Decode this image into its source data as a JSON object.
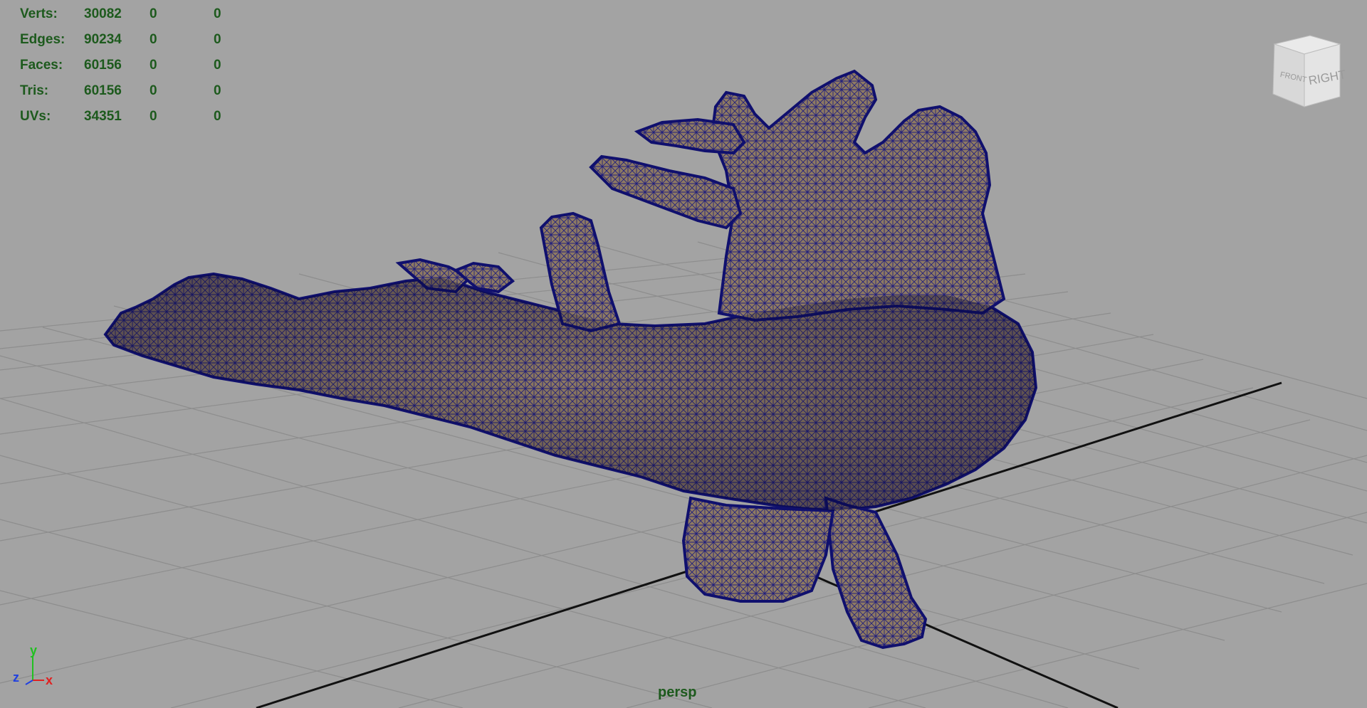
{
  "hud": {
    "rows": [
      {
        "label": "Verts:",
        "count": "30082",
        "selected": "0",
        "component": "0"
      },
      {
        "label": "Edges:",
        "count": "90234",
        "selected": "0",
        "component": "0"
      },
      {
        "label": "Faces:",
        "count": "60156",
        "selected": "0",
        "component": "0"
      },
      {
        "label": "Tris:",
        "count": "60156",
        "selected": "0",
        "component": "0"
      },
      {
        "label": "UVs:",
        "count": "34351",
        "selected": "0",
        "component": "0"
      }
    ]
  },
  "camera": {
    "name": "persp"
  },
  "viewcube": {
    "front_label": "FRONT",
    "right_label": "RIGHT"
  },
  "axis": {
    "y": "y",
    "z": "z",
    "x": "x"
  },
  "colors": {
    "background": "#a3a3a3",
    "grid": "#8c8c8c",
    "grid_axis": "#111111",
    "hud_text": "#1d5a1d",
    "wireframe": "#12127a",
    "surface": "#8e7a62"
  },
  "icons": {
    "axis_gizmo": "xyz-axis-icon",
    "view_cube": "view-cube-icon"
  }
}
